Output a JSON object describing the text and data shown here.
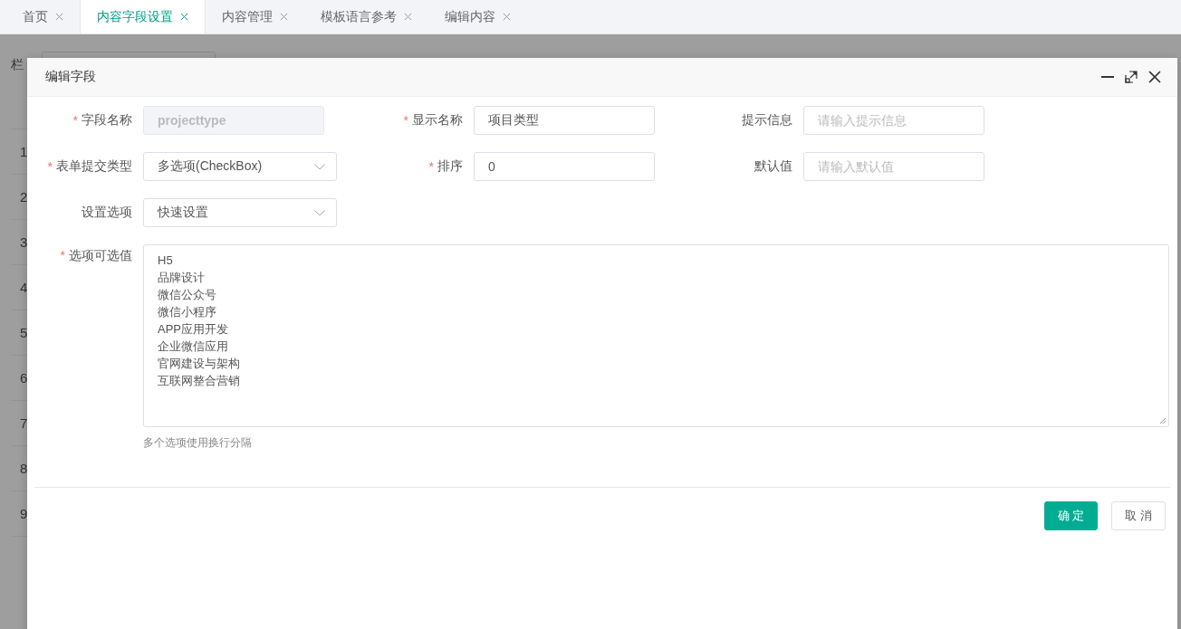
{
  "tabs": [
    {
      "label": "首页",
      "selected": false
    },
    {
      "label": "内容字段设置",
      "selected": true
    },
    {
      "label": "内容管理",
      "selected": false
    },
    {
      "label": "模板语言参考",
      "selected": false
    },
    {
      "label": "编辑内容",
      "selected": false
    }
  ],
  "background_page": {
    "filter_label": "栏",
    "row_numbers": [
      "1",
      "2",
      "3",
      "4",
      "5",
      "6",
      "7",
      "8",
      "9"
    ]
  },
  "dialog": {
    "title": "编辑字段",
    "fields": [
      {
        "kind": "text",
        "label": "字段名称",
        "required_mark": "*",
        "value": "projecttype",
        "disabled": true
      },
      {
        "kind": "text",
        "label": "显示名称",
        "required_mark": "*",
        "value": "项目类型",
        "disabled": false
      },
      {
        "kind": "text",
        "label": "提示信息",
        "placeholder": "请输入提示信息",
        "disabled": false
      },
      {
        "kind": "select",
        "label": "表单提交类型",
        "required_mark": "*",
        "value": "多选项(CheckBox)"
      },
      {
        "kind": "text",
        "label": "排序",
        "required_mark": "*",
        "value": "0",
        "disabled": false
      },
      {
        "kind": "text",
        "label": "默认值",
        "placeholder": "请输入默认值",
        "disabled": false
      },
      {
        "kind": "select",
        "label": "设置选项",
        "value": "快速设置"
      },
      {
        "kind": "textarea",
        "label": "选项可选值",
        "required_mark": "*",
        "lines": [
          "H5",
          "品牌设计",
          "微信公众号",
          "微信小程序",
          "APP应用开发",
          "企业微信应用",
          "官网建设与架构",
          "互联网整合营销"
        ],
        "hint": "多个选项使用换行分隔"
      }
    ],
    "buttons": [
      {
        "label": "确 定",
        "kind": "primary"
      },
      {
        "label": "取 消",
        "kind": "default"
      }
    ]
  }
}
